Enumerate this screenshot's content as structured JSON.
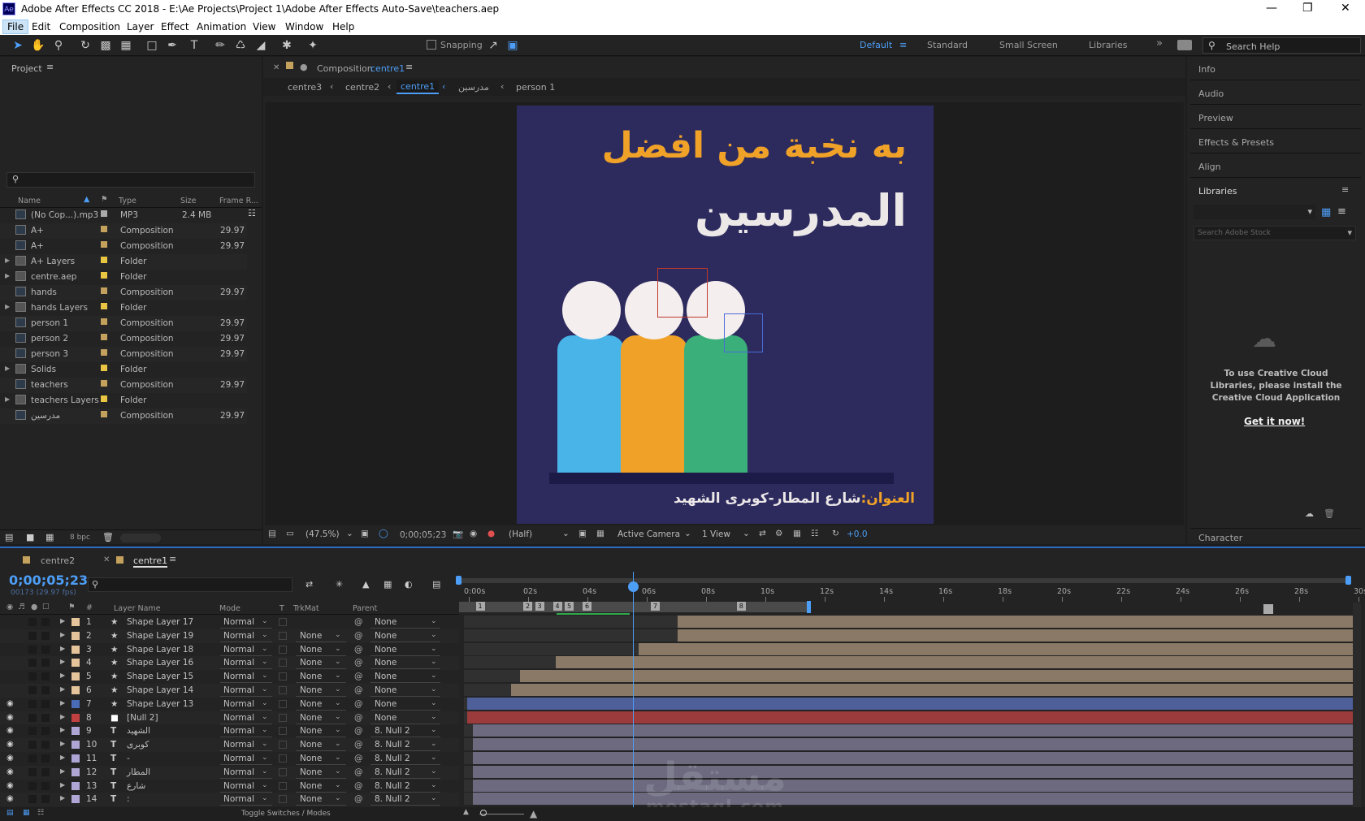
{
  "window": {
    "title": "Adobe After Effects CC 2018 - E:\\Ae Projects\\Project 1\\Adobe After Effects Auto-Save\\teachers.aep",
    "icon": "Ae"
  },
  "menu": [
    "File",
    "Edit",
    "Composition",
    "Layer",
    "Effect",
    "Animation",
    "View",
    "Window",
    "Help"
  ],
  "toolbar": {
    "snapping": "Snapping",
    "workspaces": [
      "Default",
      "Standard",
      "Small Screen",
      "Libraries"
    ],
    "search": "Search Help"
  },
  "project": {
    "title": "Project",
    "columns": {
      "name": "Name",
      "type": "Type",
      "size": "Size",
      "frame": "Frame R..."
    },
    "items": [
      {
        "name": "(No Cop...).mp3",
        "type": "MP3",
        "size": "2.4 MB",
        "fr": "",
        "color": "#aaaaaa",
        "expand": false
      },
      {
        "name": "A+",
        "type": "Composition",
        "size": "",
        "fr": "29.97",
        "color": "#c4a15c",
        "expand": false
      },
      {
        "name": "A+",
        "type": "Composition",
        "size": "",
        "fr": "29.97",
        "color": "#c4a15c",
        "expand": false
      },
      {
        "name": "A+ Layers",
        "type": "Folder",
        "size": "",
        "fr": "",
        "color": "#e8c543",
        "expand": true
      },
      {
        "name": "centre.aep",
        "type": "Folder",
        "size": "",
        "fr": "",
        "color": "#e8c543",
        "expand": true
      },
      {
        "name": "hands",
        "type": "Composition",
        "size": "",
        "fr": "29.97",
        "color": "#c4a15c",
        "expand": false
      },
      {
        "name": "hands Layers",
        "type": "Folder",
        "size": "",
        "fr": "",
        "color": "#e8c543",
        "expand": true
      },
      {
        "name": "person 1",
        "type": "Composition",
        "size": "",
        "fr": "29.97",
        "color": "#c4a15c",
        "expand": false
      },
      {
        "name": "person 2",
        "type": "Composition",
        "size": "",
        "fr": "29.97",
        "color": "#c4a15c",
        "expand": false
      },
      {
        "name": "person 3",
        "type": "Composition",
        "size": "",
        "fr": "29.97",
        "color": "#c4a15c",
        "expand": false
      },
      {
        "name": "Solids",
        "type": "Folder",
        "size": "",
        "fr": "",
        "color": "#e8c543",
        "expand": true
      },
      {
        "name": "teachers",
        "type": "Composition",
        "size": "",
        "fr": "29.97",
        "color": "#c4a15c",
        "expand": false
      },
      {
        "name": "teachers Layers",
        "type": "Folder",
        "size": "",
        "fr": "",
        "color": "#e8c543",
        "expand": true
      },
      {
        "name": "مدرسين",
        "type": "Composition",
        "size": "",
        "fr": "29.97",
        "color": "#c4a15c",
        "expand": false
      }
    ],
    "bpc": "8 bpc"
  },
  "comp": {
    "tab_prefix": "Composition",
    "tab_name": "centre1",
    "breadcrumbs": [
      "centre3",
      "centre2",
      "centre1",
      "مدرسين",
      "person 1"
    ],
    "line1": "به نخبة من افضل",
    "line2": "المدرسين",
    "addr_label": "العنوان:",
    "addr_text": "شارع المطار-كوبرى الشهيد",
    "zoom": "(47.5%)",
    "timecode": "0;00;05;23",
    "resolution": "(Half)",
    "camera": "Active Camera",
    "views": "1 View",
    "exposure": "+0.0"
  },
  "right": {
    "panels": [
      "Info",
      "Audio",
      "Preview",
      "Effects & Presets",
      "Align",
      "Libraries"
    ],
    "stock": "Search Adobe Stock",
    "cc_msg": "To use Creative Cloud Libraries, please install the Creative Cloud Application",
    "cc_link": "Get it now!",
    "character": "Character"
  },
  "timeline": {
    "tabs": [
      "centre2",
      "centre1"
    ],
    "timecode": "0;00;05;23",
    "fps": "00173 (29.97 fps)",
    "cols": {
      "layer": "Layer Name",
      "mode": "Mode",
      "t": "T",
      "trk": "TrkMat",
      "parent": "Parent"
    },
    "ruler": [
      "0:00s",
      "02s",
      "04s",
      "06s",
      "08s",
      "10s",
      "12s",
      "14s",
      "16s",
      "18s",
      "20s",
      "22s",
      "24s",
      "26s",
      "28s",
      "30s"
    ],
    "layers": [
      {
        "n": "1",
        "name": "Shape Layer 17",
        "kind": "shape",
        "color": "#e5c49b",
        "mode": "Normal",
        "trk": "",
        "parent": "None",
        "eye": false,
        "start": 7.2,
        "bar": "#8a7966"
      },
      {
        "n": "2",
        "name": "Shape Layer 19",
        "kind": "shape",
        "color": "#e5c49b",
        "mode": "Normal",
        "trk": "None",
        "parent": "None",
        "eye": false,
        "start": 7.2,
        "bar": "#8a7966"
      },
      {
        "n": "3",
        "name": "Shape Layer 18",
        "kind": "shape",
        "color": "#e5c49b",
        "mode": "Normal",
        "trk": "None",
        "parent": "None",
        "eye": false,
        "start": 5.9,
        "bar": "#8a7966"
      },
      {
        "n": "4",
        "name": "Shape Layer 16",
        "kind": "shape",
        "color": "#e5c49b",
        "mode": "Normal",
        "trk": "None",
        "parent": "None",
        "eye": false,
        "start": 3.1,
        "bar": "#8a7966"
      },
      {
        "n": "5",
        "name": "Shape Layer 15",
        "kind": "shape",
        "color": "#e5c49b",
        "mode": "Normal",
        "trk": "None",
        "parent": "None",
        "eye": false,
        "start": 1.9,
        "bar": "#8a7966"
      },
      {
        "n": "6",
        "name": "Shape Layer 14",
        "kind": "shape",
        "color": "#e5c49b",
        "mode": "Normal",
        "trk": "None",
        "parent": "None",
        "eye": false,
        "start": 1.6,
        "bar": "#8a7966"
      },
      {
        "n": "7",
        "name": "Shape Layer 13",
        "kind": "shape",
        "color": "#4a6bb8",
        "mode": "Normal",
        "trk": "None",
        "parent": "None",
        "eye": true,
        "start": 0.1,
        "bar": "#4e5f9a"
      },
      {
        "n": "8",
        "name": "[Null 2]",
        "kind": "null",
        "color": "#c14040",
        "mode": "Normal",
        "trk": "None",
        "parent": "None",
        "eye": true,
        "start": 0.1,
        "bar": "#9c3b3b"
      },
      {
        "n": "9",
        "name": "الشهيد",
        "kind": "text",
        "color": "#b0a6d6",
        "mode": "Normal",
        "trk": "None",
        "parent": "8. Null 2",
        "eye": true,
        "start": 0.3,
        "bar": "#6d6a80"
      },
      {
        "n": "10",
        "name": "كوبرى",
        "kind": "text",
        "color": "#b0a6d6",
        "mode": "Normal",
        "trk": "None",
        "parent": "8. Null 2",
        "eye": true,
        "start": 0.3,
        "bar": "#6d6a80"
      },
      {
        "n": "11",
        "name": "-",
        "kind": "text",
        "color": "#b0a6d6",
        "mode": "Normal",
        "trk": "None",
        "parent": "8. Null 2",
        "eye": true,
        "start": 0.3,
        "bar": "#6d6a80"
      },
      {
        "n": "12",
        "name": "المطار",
        "kind": "text",
        "color": "#b0a6d6",
        "mode": "Normal",
        "trk": "None",
        "parent": "8. Null 2",
        "eye": true,
        "start": 0.3,
        "bar": "#6d6a80"
      },
      {
        "n": "13",
        "name": "شارع",
        "kind": "text",
        "color": "#b0a6d6",
        "mode": "Normal",
        "trk": "None",
        "parent": "8. Null 2",
        "eye": true,
        "start": 0.3,
        "bar": "#6d6a80"
      },
      {
        "n": "14",
        "name": ":",
        "kind": "text",
        "color": "#b0a6d6",
        "mode": "Normal",
        "trk": "None",
        "parent": "8. Null 2",
        "eye": true,
        "start": 0.3,
        "bar": "#6d6a80"
      }
    ],
    "markers": [
      "1",
      "2",
      "3",
      "4",
      "5",
      "6",
      "7",
      "8"
    ],
    "toggle": "Toggle Switches / Modes",
    "watermark_ar": "مستقل",
    "watermark": "mostaql.com"
  }
}
